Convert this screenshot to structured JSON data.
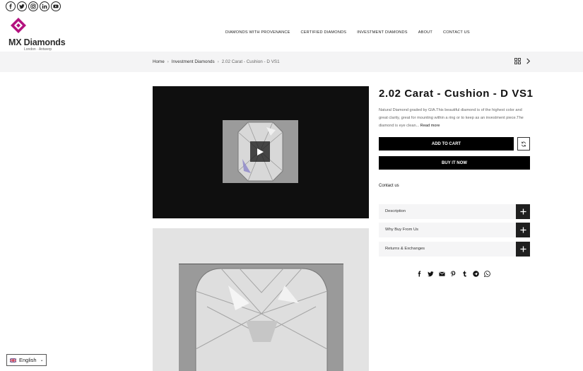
{
  "brand": {
    "name": "MX Diamonds",
    "tagline": "London · Antwerp",
    "accent_color": "#b3127f"
  },
  "socials": [
    "facebook-icon",
    "twitter-icon",
    "instagram-icon",
    "linkedin-icon",
    "youtube-icon"
  ],
  "nav": {
    "items": [
      {
        "label": "DIAMONDS WITH PROVENANCE"
      },
      {
        "label": "CERTIFIED DIAMONDS"
      },
      {
        "label": "INVESTMENT DIAMONDS"
      },
      {
        "label": "ABOUT"
      },
      {
        "label": "CONTACT US"
      }
    ]
  },
  "breadcrumb": {
    "home": "Home",
    "category": "Investment Diamonds",
    "current": "2.02 Carat - Cushion - D VS1"
  },
  "product": {
    "title": "2.02 Carat - Cushion - D VS1",
    "description": "Natural Diamond graded by GIA.This beautiful diamond is of the highest color and great clarity, great for mounting within a ring or to keep as an investment piece.The diamond is eye clean...",
    "read_more": "Read more",
    "add_to_cart": "ADD TO CART",
    "buy_now": "BUY IT NOW",
    "contact": "Contact us"
  },
  "accordion": [
    {
      "label": "Description"
    },
    {
      "label": "Why Buy From Us"
    },
    {
      "label": "Returns & Exchanges"
    }
  ],
  "share_icons": [
    "facebook-icon",
    "twitter-icon",
    "email-icon",
    "pinterest-icon",
    "tumblr-icon",
    "telegram-icon",
    "whatsapp-icon"
  ],
  "language": {
    "selected": "English"
  }
}
